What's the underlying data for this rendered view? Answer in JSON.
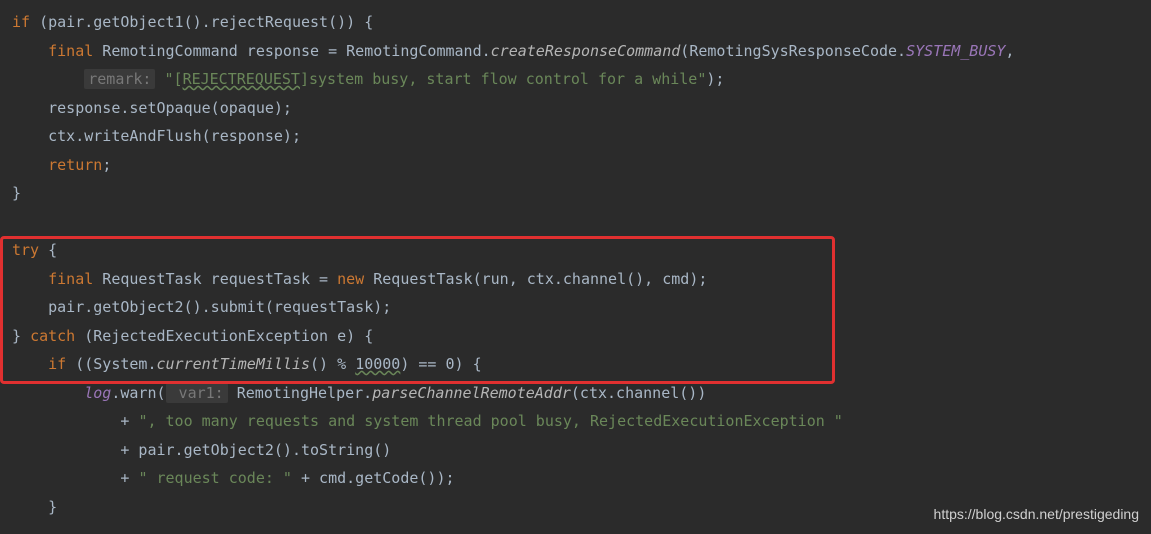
{
  "code": {
    "l1": {
      "kw_if": "if",
      "t1": " (pair.getObject1().rejectRequest()) {"
    },
    "l2": {
      "kw_final": "final",
      "t1": " RemotingCommand response = RemotingCommand.",
      "sm": "createResponseCommand",
      "t2": "(RemotingSysResponseCode.",
      "sv": "SYSTEM_BUSY",
      "t3": ","
    },
    "l3": {
      "hint": "remark:",
      "s1": " \"[",
      "u1": "REJECTREQUEST",
      "s2": "]system busy, start flow control for a while\"",
      "t1": ");"
    },
    "l4": {
      "t1": "response.setOpaque(opaque);"
    },
    "l5": {
      "t1": "ctx.writeAndFlush(response);"
    },
    "l6": {
      "kw_return": "return",
      "t1": ";"
    },
    "l7": {
      "t1": "}"
    },
    "l8": {
      "kw_try": "try",
      "t1": " {"
    },
    "l9": {
      "kw_final": "final",
      "t1": " RequestTask requestTask = ",
      "kw_new": "new",
      "t2": " RequestTask(run, ctx.channel(), cmd);"
    },
    "l10": {
      "t1": "pair.getObject2().submit(requestTask);"
    },
    "l11": {
      "t1": "} ",
      "kw_catch": "catch",
      "t2": " (RejectedExecutionException e) {"
    },
    "l12": {
      "kw_if": "if",
      "t1": " ((System.",
      "sm": "currentTimeMillis",
      "t2": "() % ",
      "u1": "10000",
      "t3": ") == 0) {"
    },
    "l13": {
      "sv": "log",
      "t1": ".warn(",
      "hint": " var1:",
      "t2": " RemotingHelper.",
      "sm": "parseChannelRemoteAddr",
      "t3": "(ctx.channel())"
    },
    "l14": {
      "t1": "+ ",
      "s1": "\", too many requests and system thread pool busy, RejectedExecutionException \""
    },
    "l15": {
      "t1": "+ pair.getObject2().toString()"
    },
    "l16": {
      "t1": "+ ",
      "s1": "\" request code: \"",
      "t2": " + cmd.getCode());"
    },
    "l17": {
      "t1": "}"
    }
  },
  "watermark": "https://blog.csdn.net/prestigeding"
}
